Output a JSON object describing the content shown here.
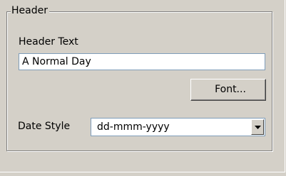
{
  "header_group": {
    "title": "Header",
    "header_text_label": "Header Text",
    "header_text_value": "A Normal Day",
    "font_button_label": "Font...",
    "date_style_label": "Date Style",
    "date_style_value": "dd-mmm-yyyy"
  },
  "icons": {
    "dropdown": "chevron-down-icon"
  },
  "colors": {
    "background": "#d4d0c8",
    "input_border": "#7f9db9",
    "group_border": "#808080"
  }
}
